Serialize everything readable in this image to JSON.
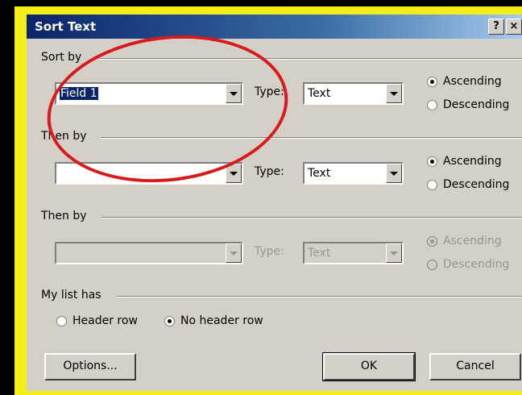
{
  "dialog": {
    "title": "Sort Text",
    "help_label": "?",
    "close_label": "×"
  },
  "sort_by": {
    "label": "Sort by",
    "field_value": "Field 1",
    "type_label": "Type:",
    "type_value": "Text",
    "ascending_label": "Ascending",
    "descending_label": "Descending",
    "selected": "ascending"
  },
  "then_by_1": {
    "label": "Then by",
    "field_value": "",
    "type_label": "Type:",
    "type_value": "Text",
    "ascending_label": "Ascending",
    "descending_label": "Descending",
    "selected": "ascending"
  },
  "then_by_2": {
    "label": "Then by",
    "field_value": "",
    "type_label": "Type:",
    "type_value": "Text",
    "ascending_label": "Ascending",
    "descending_label": "Descending",
    "selected": "ascending",
    "disabled": true
  },
  "list_has": {
    "label": "My list has",
    "header_row_label": "Header row",
    "no_header_row_label": "No header row",
    "selected": "no_header_row"
  },
  "buttons": {
    "options_label": "Options...",
    "ok_label": "OK",
    "cancel_label": "Cancel"
  },
  "annotation": {
    "color": "#d81a1a"
  }
}
